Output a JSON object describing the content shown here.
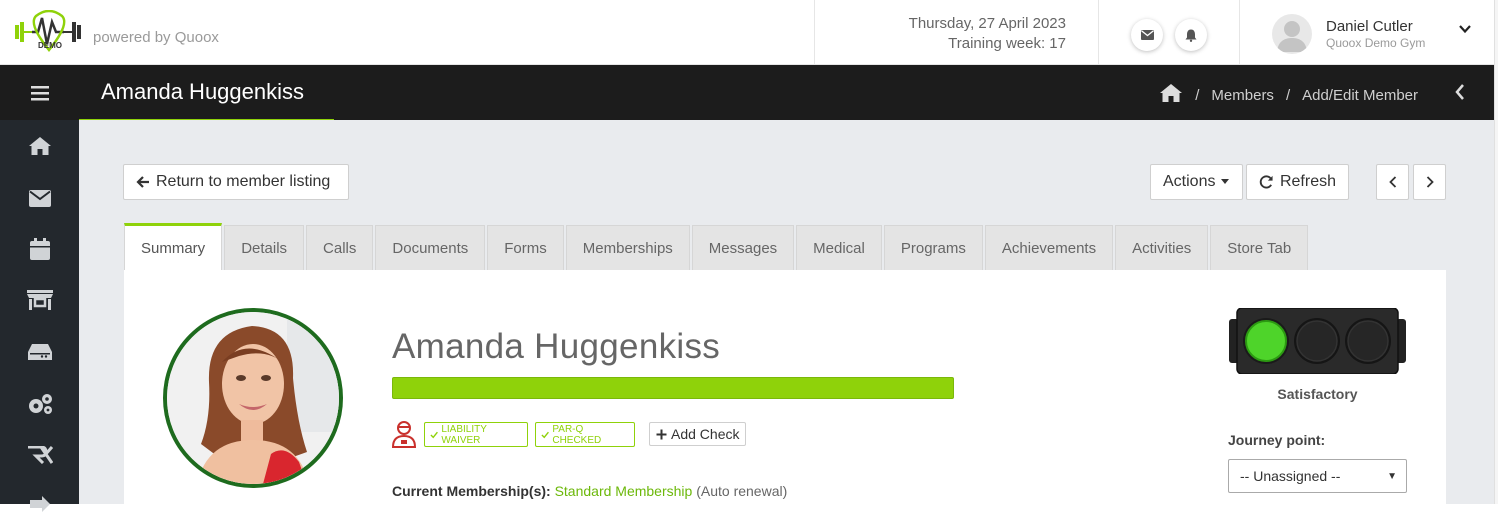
{
  "topbar": {
    "logo_text": "DEMO",
    "powered_by": "powered by Quoox",
    "date": "Thursday, 27 April 2023",
    "training_week": "Training week: 17",
    "user_name": "Daniel Cutler",
    "user_gym": "Quoox Demo Gym"
  },
  "header": {
    "title": "Amanda Huggenkiss",
    "breadcrumbs": [
      "Members",
      "Add/Edit Member"
    ]
  },
  "sidebar": {
    "items": [
      "home-icon",
      "mail-icon",
      "calendar-icon",
      "store-icon",
      "drive-icon",
      "settings-icon",
      "rx-icon",
      "exit-icon"
    ]
  },
  "toolbar": {
    "return_label": "Return to member listing",
    "actions_label": "Actions",
    "refresh_label": "Refresh"
  },
  "tabs": [
    "Summary",
    "Details",
    "Calls",
    "Documents",
    "Forms",
    "Memberships",
    "Messages",
    "Medical",
    "Programs",
    "Achievements",
    "Activities",
    "Store Tab"
  ],
  "member": {
    "name": "Amanda Huggenkiss",
    "badges": [
      "LIABILITY WAIVER",
      "PAR-Q CHECKED"
    ],
    "add_check_label": "Add Check",
    "membership_label": "Current Membership(s):",
    "membership_name": "Standard Membership",
    "membership_note": "(Auto renewal)"
  },
  "status": {
    "label": "Satisfactory",
    "active_light": "green",
    "journey_label": "Journey point:",
    "journey_value": "-- Unassigned --"
  },
  "colors": {
    "accent": "#8fd20a",
    "header_bg": "#1c1c1c",
    "sidebar_bg": "#23282d",
    "photo_border": "#1e6b1e"
  }
}
